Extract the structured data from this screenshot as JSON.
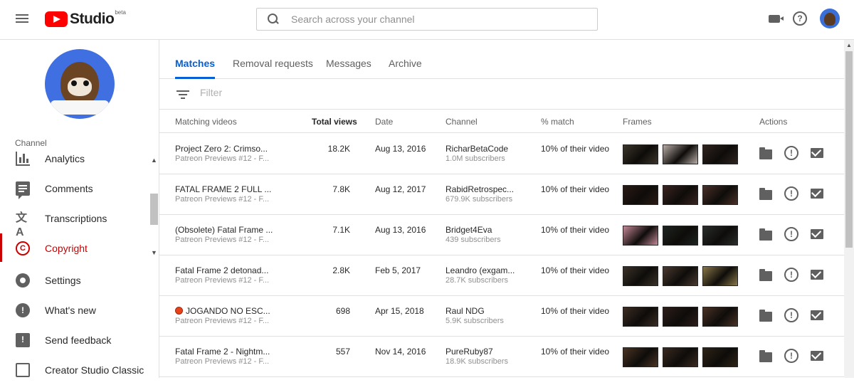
{
  "header": {
    "logo_text": "Studio",
    "logo_badge": "beta",
    "search_placeholder": "Search across your channel"
  },
  "sidebar": {
    "section_label": "Channel",
    "items": [
      {
        "label": "Analytics",
        "icon": "analytics-icon"
      },
      {
        "label": "Comments",
        "icon": "comments-icon"
      },
      {
        "label": "Transcriptions",
        "icon": "transcriptions-icon"
      },
      {
        "label": "Copyright",
        "icon": "copyright-icon",
        "active": true
      }
    ],
    "lower_items": [
      {
        "label": "Settings",
        "icon": "gear-icon"
      },
      {
        "label": "What's new",
        "icon": "whats-new-icon"
      },
      {
        "label": "Send feedback",
        "icon": "feedback-icon"
      },
      {
        "label": "Creator Studio Classic",
        "icon": "classic-studio-icon"
      }
    ]
  },
  "main": {
    "tabs": [
      {
        "label": "Matches",
        "active": true
      },
      {
        "label": "Removal requests"
      },
      {
        "label": "Messages"
      },
      {
        "label": "Archive"
      }
    ],
    "filter_placeholder": "Filter",
    "columns": [
      "Matching videos",
      "Total views",
      "Date",
      "Channel",
      "% match",
      "Frames",
      "Actions"
    ],
    "rows": [
      {
        "title": "Project Zero 2: Crimso...",
        "subtitle": "Patreon Previews #12 - F...",
        "views": "18.2K",
        "date": "Aug 13, 2016",
        "channel": "RicharBetaCode",
        "subscribers": "1.0M subscribers",
        "match": "10% of their video",
        "frame_colors": [
          "#3b352a",
          "#b8aca6",
          "#2f2420"
        ]
      },
      {
        "title": "FATAL FRAME 2 FULL ...",
        "subtitle": "Patreon Previews #12 - F...",
        "views": "7.8K",
        "date": "Aug 12, 2017",
        "channel": "RabidRetrospec...",
        "subscribers": "679.9K subscribers",
        "match": "10% of their video",
        "frame_colors": [
          "#2a1a14",
          "#3a2420",
          "#4a3028"
        ]
      },
      {
        "title": "(Obsolete) Fatal Frame ...",
        "subtitle": "Patreon Previews #12 - F...",
        "views": "7.1K",
        "date": "Aug 13, 2016",
        "channel": "Bridget4Eva",
        "subscribers": "439 subscribers",
        "match": "10% of their video",
        "frame_colors": [
          "#c48898",
          "#1e2420",
          "#2a2e2c"
        ]
      },
      {
        "title": "Fatal Frame 2 detonad...",
        "subtitle": "Patreon Previews #12 - F...",
        "views": "2.8K",
        "date": "Feb 5, 2017",
        "channel": "Leandro (exgam...",
        "subscribers": "28.7K subscribers",
        "match": "10% of their video",
        "frame_colors": [
          "#3a3228",
          "#4a3a30",
          "#8a7848"
        ]
      },
      {
        "title": "JOGANDO NO ESC...",
        "subtitle": "Patreon Previews #12 - F...",
        "views": "698",
        "date": "Apr 15, 2018",
        "channel": "Raul NDG",
        "subscribers": "5.9K subscribers",
        "match": "10% of their video",
        "live": true,
        "frame_colors": [
          "#3c2c24",
          "#2c1e1a",
          "#4a3226"
        ]
      },
      {
        "title": "Fatal Frame 2 - Nightm...",
        "subtitle": "Patreon Previews #12 - F...",
        "views": "557",
        "date": "Nov 14, 2016",
        "channel": "PureRuby87",
        "subscribers": "18.9K subscribers",
        "match": "10% of their video",
        "frame_colors": [
          "#4a3424",
          "#3a2a20",
          "#2e2418"
        ]
      }
    ]
  }
}
